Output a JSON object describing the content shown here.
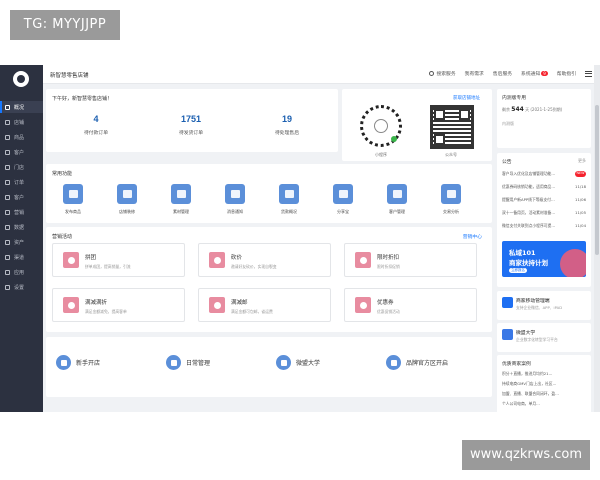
{
  "watermark_top": "TG: MYYJJPP",
  "watermark_bottom": "www.qzkrws.com",
  "shop_name": "新智慧零售店铺",
  "sidebar": {
    "items": [
      {
        "label": "概况",
        "active": true
      },
      {
        "label": "店铺"
      },
      {
        "label": "商品"
      },
      {
        "label": "客户"
      },
      {
        "label": "门店"
      },
      {
        "label": "订单"
      },
      {
        "label": "客户"
      },
      {
        "label": "营销"
      },
      {
        "label": "数据"
      },
      {
        "label": "资产"
      },
      {
        "label": "渠道"
      },
      {
        "label": "应用"
      },
      {
        "label": "设置"
      }
    ]
  },
  "topbar": {
    "search_label": "搜索服务",
    "items": [
      "我有需求",
      "售后服务",
      "系统通知",
      "帮助指引"
    ],
    "notification_count": "9"
  },
  "greeting": "下午好，新智慧零售店铺！",
  "stats": [
    {
      "value": "4",
      "label": "待付款订单"
    },
    {
      "value": "1751",
      "label": "待发货订单"
    },
    {
      "value": "19",
      "label": "待处理售后"
    }
  ],
  "qr_panel": {
    "link": "获取店铺地址",
    "mini_caption": "小程序",
    "official_caption": "公众号"
  },
  "common_functions": {
    "title": "常用功能",
    "items": [
      "发布商品",
      "店铺装修",
      "素材管理",
      "消息通知",
      "货款概况",
      "分享宝",
      "客户管理",
      "交易分析"
    ]
  },
  "marketing": {
    "title": "营销活动",
    "link": "营销中心",
    "cards": [
      {
        "title": "拼团",
        "desc": "拼单成团，提高销量，引流"
      },
      {
        "title": "砍价",
        "desc": "邀请好友砍价，实现自裂变"
      },
      {
        "title": "限时折扣",
        "desc": "限时折扣促销"
      },
      {
        "title": "满减满折",
        "desc": "满足金额减免，提高客单"
      },
      {
        "title": "满减邮",
        "desc": "满足金额可包邮，省运费"
      },
      {
        "title": "优惠券",
        "desc": "优惠促销活动"
      }
    ]
  },
  "guides": [
    "新手开店",
    "日常管理",
    "微盟大学",
    "品牌官方区开启"
  ],
  "version": {
    "title": "内测版专用",
    "days_label": "剩余",
    "days": "544",
    "days_unit": "天",
    "date": "(2021-1-25到期)",
    "sub": "内测版"
  },
  "notice": {
    "title": "公告",
    "more": "更多",
    "items": [
      {
        "text": "客户导入优化及店铺管理功能…",
        "tag": "NEW"
      },
      {
        "text": "优惠券码核销功能，适用商品…",
        "date": "11/18"
      },
      {
        "text": "提醒用户新APP线下等级支付…",
        "date": "11/06"
      },
      {
        "text": "双十一备用页，活动素材准备…",
        "date": "11/05"
      },
      {
        "text": "微信支付关联到点小程序可提…",
        "date": "11/04"
      }
    ]
  },
  "banner": {
    "line1": "私域101",
    "line2": "商家扶持计划",
    "button": "立即报名"
  },
  "apps": [
    {
      "name": "商家移动管理端",
      "desc": "支持企业微信、APP、iPAD"
    },
    {
      "name": "微盟大学",
      "desc": "企业数字化转型学习平台"
    }
  ],
  "cases": {
    "title": "优质商家案例",
    "items": [
      "积分＋直播，推进月均约21…",
      "持续电商GMV门店上出，社区…",
      "加盟、直播、联盟合同闭环，盈…",
      "个人公司电商，单月..."
    ]
  }
}
